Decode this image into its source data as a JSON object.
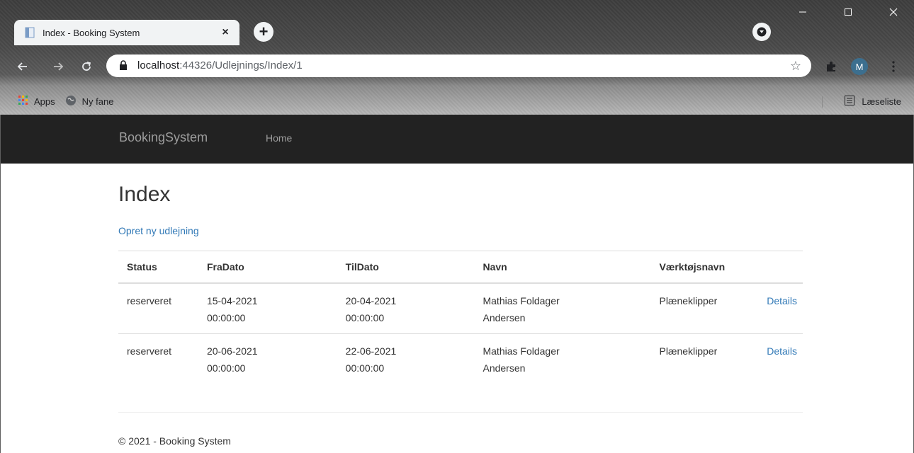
{
  "browser": {
    "tab_title": "Index - Booking System",
    "tab_close": "×",
    "new_tab": "+",
    "url_host": "localhost",
    "url_path": ":44326/Udlejnings/Index/1",
    "avatar_initial": "M",
    "bookmarks": [
      {
        "label": "Apps",
        "icon": "apps-grid-icon"
      },
      {
        "label": "Ny fane",
        "icon": "globe-icon"
      }
    ],
    "reading_list": "Læseliste"
  },
  "site": {
    "brand": "BookingSystem",
    "nav_home": "Home",
    "heading": "Index",
    "create_link": "Opret ny udlejning",
    "table": {
      "headers": [
        "Status",
        "FraDato",
        "TilDato",
        "Navn",
        "Værktøjsnavn"
      ],
      "rows": [
        {
          "status": "reserveret",
          "fra_date": "15-04-2021",
          "fra_time": "00:00:00",
          "til_date": "20-04-2021",
          "til_time": "00:00:00",
          "navn_line1": "Mathias Foldager",
          "navn_line2": "Andersen",
          "vaerktoj": "Plæneklipper",
          "details": "Details"
        },
        {
          "status": "reserveret",
          "fra_date": "20-06-2021",
          "fra_time": "00:00:00",
          "til_date": "22-06-2021",
          "til_time": "00:00:00",
          "navn_line1": "Mathias Foldager",
          "navn_line2": "Andersen",
          "vaerktoj": "Plæneklipper",
          "details": "Details"
        }
      ]
    },
    "footer": "© 2021 - Booking System"
  },
  "colors": {
    "navbar_bg": "#222222",
    "link": "#337ab7",
    "nav_text": "#9d9d9d"
  }
}
